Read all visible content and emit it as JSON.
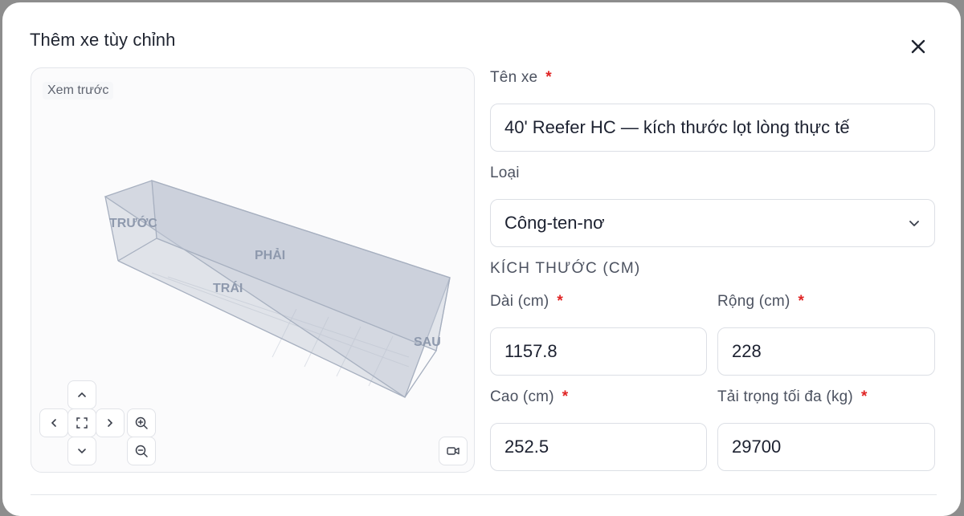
{
  "dialog": {
    "title": "Thêm xe tùy chỉnh",
    "close_icon": "close-icon"
  },
  "preview": {
    "label": "Xem trước",
    "faces": {
      "front": "TRƯỚC",
      "right": "PHẢI",
      "left": "TRÁI",
      "back": "SAU"
    },
    "controls": {
      "pan_up_icon": "chevron-up-icon",
      "pan_left_icon": "chevron-left-icon",
      "fit_icon": "fit-screen-icon",
      "pan_right_icon": "chevron-right-icon",
      "pan_down_icon": "chevron-down-icon",
      "zoom_in_icon": "zoom-in-icon",
      "zoom_out_icon": "zoom-out-icon",
      "camera_icon": "video-camera-icon"
    },
    "colors": {
      "box_fill": "#b4bccb",
      "box_edge": "#a6afbf",
      "face_label": "#8e99ad"
    }
  },
  "form": {
    "name": {
      "label": "Tên xe",
      "required": "*",
      "value": "40' Reefer HC — kích thước lọt lòng thực tế"
    },
    "type": {
      "label": "Loại",
      "selected": "Công-ten-nơ"
    },
    "dimensions": {
      "section_title": "KÍCH THƯỚC (CM)",
      "length": {
        "label": "Dài (cm)",
        "required": "*",
        "value": "1157.8"
      },
      "width": {
        "label": "Rộng (cm)",
        "required": "*",
        "value": "228"
      },
      "height": {
        "label": "Cao (cm)",
        "required": "*",
        "value": "252.5"
      },
      "max_load": {
        "label": "Tải trọng tối đa (kg)",
        "required": "*",
        "value": "29700"
      }
    }
  },
  "colors": {
    "required": "#e02424",
    "text": "#1c2130",
    "muted": "#4c5260",
    "border": "#dcdfe5"
  }
}
